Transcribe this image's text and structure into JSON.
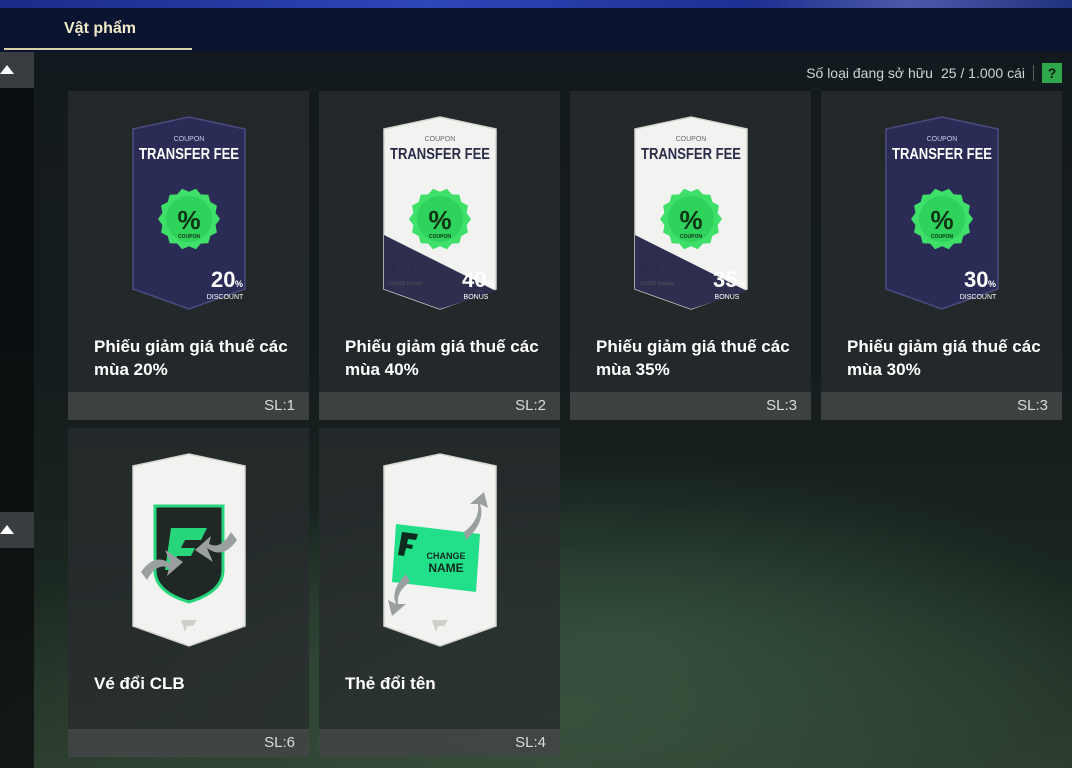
{
  "header": {
    "tab_label": "Vật phẩm"
  },
  "owned": {
    "label": "Số loại đang sở hữu",
    "count": "25 / 1.000 cái",
    "help": "?"
  },
  "items": [
    {
      "name": "Phiếu giảm giá thuế các mùa 20%",
      "qty": "SL:1",
      "art": {
        "kind": "coupon",
        "theme": "dark",
        "top": "COUPON",
        "title": "TRANSFER FEE",
        "badge": "COUPON",
        "amount": "20",
        "unit": "%",
        "tag": "DISCOUNT",
        "class": "",
        "class_sub": ""
      }
    },
    {
      "name": "Phiếu giảm giá thuế các mùa 40%",
      "qty": "SL:2",
      "art": {
        "kind": "coupon",
        "theme": "light",
        "top": "COUPON",
        "title": "TRANSFER FEE",
        "badge": "COUPON",
        "amount": "40",
        "unit": "%",
        "tag": "BONUS",
        "class": "ALL",
        "class_sub": "CLASS Include"
      }
    },
    {
      "name": "Phiếu giảm giá thuế các mùa 35%",
      "qty": "SL:3",
      "art": {
        "kind": "coupon",
        "theme": "light",
        "top": "COUPON",
        "title": "TRANSFER FEE",
        "badge": "COUPON",
        "amount": "35",
        "unit": "%",
        "tag": "BONUS",
        "class": "All",
        "class_sub": "CLASS Include"
      }
    },
    {
      "name": "Phiếu giảm giá thuế các mùa 30%",
      "qty": "SL:3",
      "art": {
        "kind": "coupon",
        "theme": "dark",
        "top": "COUPON",
        "title": "TRANSFER FEE",
        "badge": "COUPON",
        "amount": "30",
        "unit": "%",
        "tag": "DISCOUNT",
        "class": "",
        "class_sub": ""
      }
    },
    {
      "name": "Vé đổi CLB",
      "qty": "SL:6",
      "art": {
        "kind": "club",
        "label": "",
        "label2": ""
      }
    },
    {
      "name": "Thẻ đổi tên",
      "qty": "SL:4",
      "art": {
        "kind": "rename",
        "label": "CHANGE",
        "label2": "NAME"
      }
    }
  ],
  "colors": {
    "accent_green": "#3ee06a",
    "tab_underline": "#d9d0a4",
    "dark_card": "#2b2c55",
    "light_card": "#f2f2f0"
  },
  "icons": {
    "scroll_up": "triangle-up-icon",
    "help": "help-icon"
  }
}
